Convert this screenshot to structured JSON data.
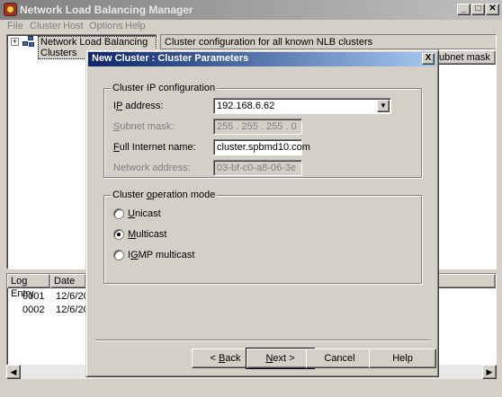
{
  "window": {
    "title": "Network Load Balancing Manager",
    "minimize_label": "_",
    "maximize_label": "□",
    "close_label": "✕"
  },
  "menu": [
    "File",
    "Cluster",
    "Host",
    "Options",
    "Help"
  ],
  "tree": {
    "expander": "+",
    "root_label": "Network Load Balancing Clusters"
  },
  "right_pane": {
    "header_text": "Cluster configuration for all known NLB clusters",
    "partial_column": "ubnet mask"
  },
  "log": {
    "columns": [
      "Log Entry",
      "Date"
    ],
    "rows": [
      {
        "entry": "0001",
        "date": "12/6/20"
      },
      {
        "entry": "0002",
        "date": "12/6/20"
      }
    ]
  },
  "dialog": {
    "title": "New Cluster : Cluster Parameters",
    "close_label": "X",
    "ip_group": {
      "legend": "Cluster IP configuration",
      "ip_label": "IP address:",
      "ip_value": "192.168.6.62",
      "subnet_label": "Subnet mask:",
      "subnet_value": " 255 . 255 . 255 .  0",
      "fqdn_label": "Full Internet name:",
      "fqdn_value": "cluster.spbmd10.com",
      "netaddr_label": "Network address:",
      "netaddr_value": "03-bf-c0-a8-06-3e"
    },
    "mode_group": {
      "legend": "Cluster operation mode",
      "options": [
        "Unicast",
        "Multicast",
        "IGMP multicast"
      ],
      "selected": "Multicast"
    },
    "buttons": {
      "back": "< Back",
      "next": "Next >",
      "cancel": "Cancel",
      "help": "Help"
    }
  }
}
